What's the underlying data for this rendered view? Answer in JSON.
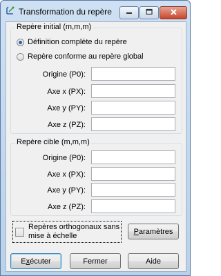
{
  "window": {
    "title": "Transformation du repère",
    "icon": "transform-icon",
    "buttons": {
      "minimize": "minimize-icon",
      "maximize": "maximize-icon",
      "close": "close-icon"
    }
  },
  "source_group": {
    "legend": "Repère initial (m,m,m)",
    "radio_full": "Définition complète du repère",
    "radio_full_checked": true,
    "radio_global": "Repère conforme au repère global",
    "radio_global_checked": false,
    "fields": [
      {
        "label": "Origine (P0):",
        "value": ""
      },
      {
        "label": "Axe x (PX):",
        "value": ""
      },
      {
        "label": "Axe y (PY):",
        "value": ""
      },
      {
        "label": "Axe z (PZ):",
        "value": ""
      }
    ]
  },
  "target_group": {
    "legend": "Repère cible (m,m,m)",
    "fields": [
      {
        "label": "Origine (P0):",
        "value": ""
      },
      {
        "label": "Axe x (PX):",
        "value": ""
      },
      {
        "label": "Axe y (PY):",
        "value": ""
      },
      {
        "label": "Axe z (PZ):",
        "value": ""
      }
    ]
  },
  "options": {
    "orthonormal_label": "Repères orthogonaux sans mise à échelle",
    "orthonormal_checked": false,
    "parameters_button_pre": "",
    "parameters_button_key": "P",
    "parameters_button_post": "aramètres"
  },
  "footer": {
    "execute_pre": "E",
    "execute_key": "x",
    "execute_post": "écuter",
    "close_label": "Fermer",
    "help_label": "Aide"
  },
  "colors": {
    "accent": "#2f5fae",
    "title_bar": "#b9d1ea",
    "client_bg": "#f0f0f0"
  }
}
